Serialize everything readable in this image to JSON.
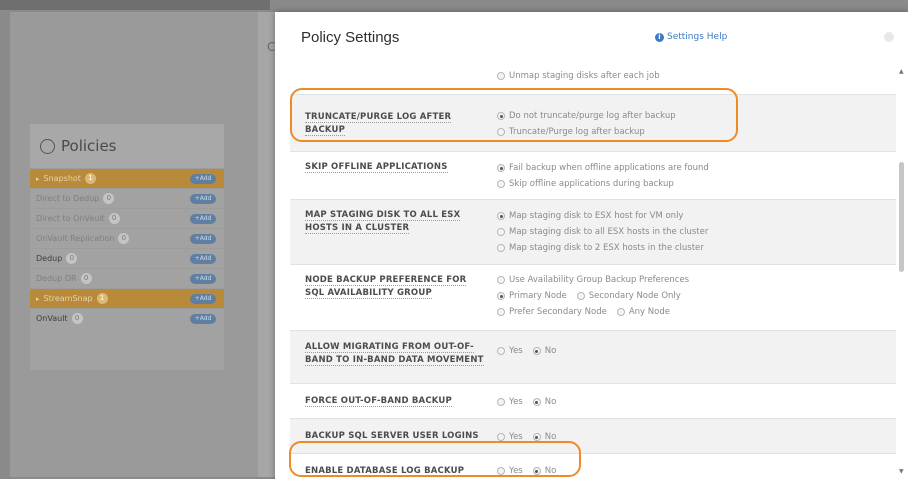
{
  "background": {
    "panel_letter": "C",
    "policies": {
      "title": "Policies",
      "rows": [
        {
          "label": "Snapshot",
          "count": "1",
          "type": "header",
          "add": "+Add"
        },
        {
          "label": "Direct to Dedup",
          "count": "0",
          "type": "muted",
          "add": "+Add"
        },
        {
          "label": "Direct to OnVault",
          "count": "0",
          "type": "muted",
          "add": "+Add"
        },
        {
          "label": "OnVault Replication",
          "count": "0",
          "type": "muted",
          "add": "+Add"
        },
        {
          "label": "Dedup",
          "count": "0",
          "type": "dark",
          "add": "+Add"
        },
        {
          "label": "Dedup DR",
          "count": "0",
          "type": "muted",
          "add": "+Add"
        },
        {
          "label": "StreamSnap",
          "count": "1",
          "type": "header",
          "add": "+Add"
        },
        {
          "label": "OnVault",
          "count": "0",
          "type": "dark",
          "add": "+Add"
        }
      ]
    }
  },
  "modal": {
    "title": "Policy Settings",
    "help_label": "Settings Help",
    "partial_option": "Unmap staging disks after each job",
    "settings": [
      {
        "label": "TRUNCATE/PURGE LOG AFTER BACKUP",
        "options": [
          [
            "Do not truncate/purge log after backup"
          ],
          [
            "Truncate/Purge log after backup"
          ]
        ],
        "selected": "Do not truncate/purge log after backup"
      },
      {
        "label": "SKIP OFFLINE APPLICATIONS",
        "options": [
          [
            "Fail backup when offline applications are found"
          ],
          [
            "Skip offline applications during backup"
          ]
        ],
        "selected": "Fail backup when offline applications are found"
      },
      {
        "label": "MAP STAGING DISK TO ALL ESX HOSTS IN A CLUSTER",
        "options": [
          [
            "Map staging disk to ESX host for VM only"
          ],
          [
            "Map staging disk to all ESX hosts in the cluster"
          ],
          [
            "Map staging disk to 2 ESX hosts in the cluster"
          ]
        ],
        "selected": "Map staging disk to ESX host for VM only"
      },
      {
        "label": "NODE BACKUP PREFERENCE FOR SQL AVAILABILITY GROUP",
        "options": [
          [
            "Use Availability Group Backup Preferences"
          ],
          [
            "Primary Node",
            "Secondary Node Only"
          ],
          [
            "Prefer Secondary Node",
            "Any Node"
          ]
        ],
        "selected": "Primary Node"
      },
      {
        "label": "ALLOW MIGRATING FROM OUT-OF-BAND TO IN-BAND DATA MOVEMENT",
        "options": [
          [
            "Yes",
            "No"
          ]
        ],
        "selected": "No"
      },
      {
        "label": "FORCE OUT-OF-BAND BACKUP",
        "options": [
          [
            "Yes",
            "No"
          ]
        ],
        "selected": "No"
      },
      {
        "label": "BACKUP SQL SERVER USER LOGINS",
        "options": [
          [
            "Yes",
            "No"
          ]
        ],
        "selected": "No"
      },
      {
        "label": "ENABLE DATABASE LOG BACKUP",
        "options": [
          [
            "Yes",
            "No"
          ]
        ],
        "selected": "No"
      }
    ],
    "highlight_color": "#f08a24"
  }
}
